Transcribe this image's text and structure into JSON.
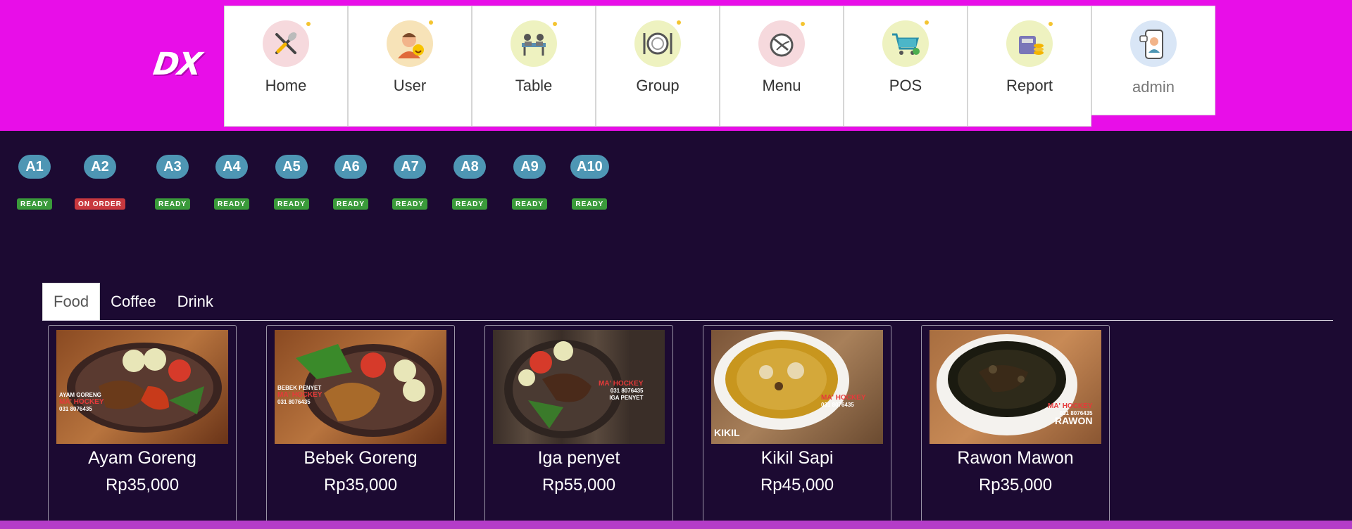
{
  "logo": {
    "text": "DX"
  },
  "nav": [
    {
      "label": "Home",
      "icon": "fork-spoon-icon"
    },
    {
      "label": "User",
      "icon": "user-avatar-icon"
    },
    {
      "label": "Table",
      "icon": "table-meeting-icon"
    },
    {
      "label": "Group",
      "icon": "plate-cutlery-icon"
    },
    {
      "label": "Menu",
      "icon": "dish-menu-icon"
    },
    {
      "label": "POS",
      "icon": "shopping-cart-icon"
    },
    {
      "label": "Report",
      "icon": "cash-register-icon"
    },
    {
      "label": "admin",
      "icon": "admin-phone-icon"
    }
  ],
  "tables": [
    {
      "name": "A1",
      "status": "READY"
    },
    {
      "name": "A2",
      "status": "ON ORDER"
    },
    {
      "name": "A3",
      "status": "READY"
    },
    {
      "name": "A4",
      "status": "READY"
    },
    {
      "name": "A5",
      "status": "READY"
    },
    {
      "name": "A6",
      "status": "READY"
    },
    {
      "name": "A7",
      "status": "READY"
    },
    {
      "name": "A8",
      "status": "READY"
    },
    {
      "name": "A9",
      "status": "READY"
    },
    {
      "name": "A10",
      "status": "READY"
    }
  ],
  "tabs": [
    {
      "label": "Food",
      "active": true
    },
    {
      "label": "Coffee",
      "active": false
    },
    {
      "label": "Drink",
      "active": false
    }
  ],
  "products": [
    {
      "name": "Ayam Goreng",
      "price": "Rp35,000",
      "photo_text": "AYAM GORENG",
      "brand": "MA' HOCKEY",
      "phone": "031 8076435"
    },
    {
      "name": "Bebek Goreng",
      "price": "Rp35,000",
      "photo_text": "BEBEK PENYET",
      "brand": "MA' HOCKEY",
      "phone": "031 8076435"
    },
    {
      "name": "Iga penyet",
      "price": "Rp55,000",
      "photo_text": "IGA PENYET",
      "brand": "MA' HOCKEY",
      "phone": "031 8076435"
    },
    {
      "name": "Kikil Sapi",
      "price": "Rp45,000",
      "photo_text": "KIKIL",
      "brand": "MA' HOCKEY",
      "phone": "031 8076435"
    },
    {
      "name": "Rawon Mawon",
      "price": "Rp35,000",
      "photo_text": "RAWON",
      "brand": "MA' HOCKEY",
      "phone": "031 8076435"
    }
  ],
  "colors": {
    "topbar": "#e80ee8",
    "background": "#1c0a32",
    "table_button": "#4e96b4",
    "status_ready": "#3a9a3a",
    "status_on_order": "#c8383e"
  }
}
